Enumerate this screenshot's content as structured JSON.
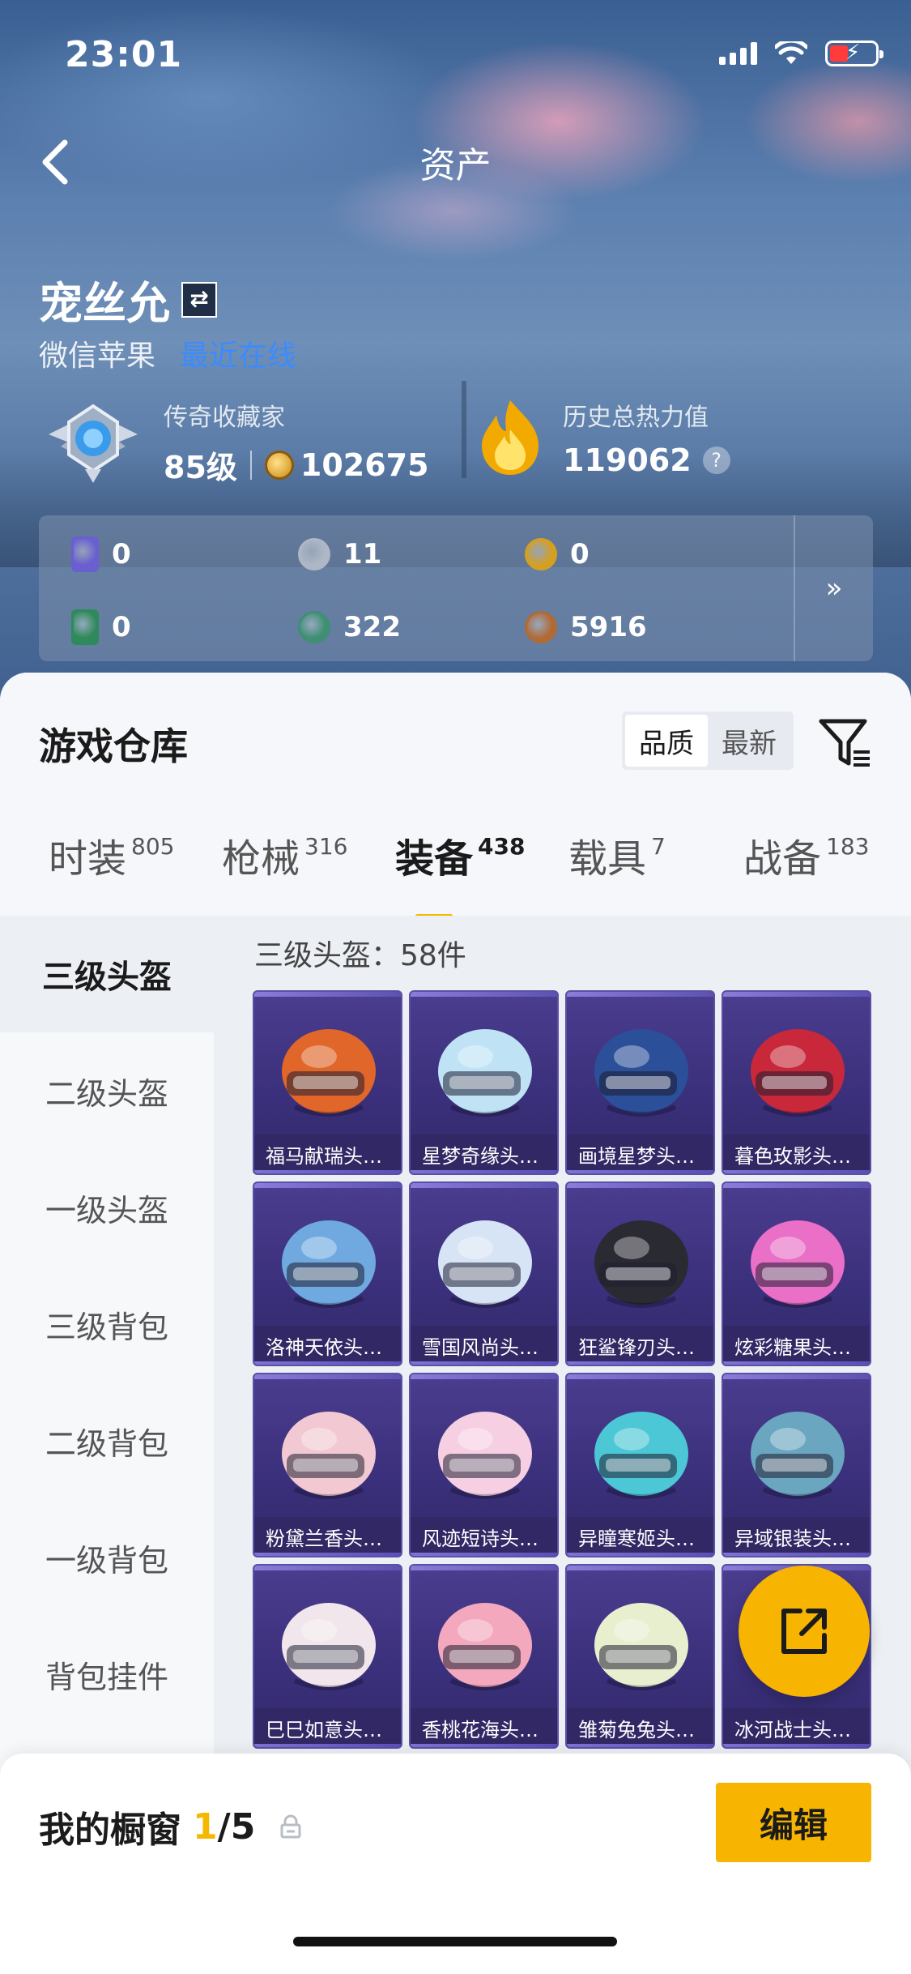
{
  "status_bar": {
    "time": "23:01"
  },
  "nav": {
    "title": "资产"
  },
  "profile": {
    "name": "宠丝允",
    "platform": "微信苹果",
    "status": "最近在线",
    "collector": {
      "title": "传奇收藏家",
      "level": "85级",
      "coins": "102675"
    },
    "heat": {
      "title": "历史总热力值",
      "value": "119062",
      "help": "?"
    }
  },
  "currencies": [
    {
      "icon": "purple-card-icon",
      "value": "0",
      "color": "#6a5fd0"
    },
    {
      "icon": "silver-coin-icon",
      "value": "11",
      "color": "#aeb7c5"
    },
    {
      "icon": "gold-medal-icon",
      "value": "0",
      "color": "#d5a021"
    },
    {
      "icon": "green-card-icon",
      "value": "0",
      "color": "#2e8a5a"
    },
    {
      "icon": "green-orb-icon",
      "value": "322",
      "color": "#3e8f73"
    },
    {
      "icon": "bronze-coin-icon",
      "value": "5916",
      "color": "#b06a35"
    }
  ],
  "currency_more": "»",
  "warehouse": {
    "title": "游戏仓库",
    "sort": {
      "quality": "品质",
      "newest": "最新"
    }
  },
  "tabs": [
    {
      "label": "时装",
      "count": "805"
    },
    {
      "label": "枪械",
      "count": "316"
    },
    {
      "label": "装备",
      "count": "438"
    },
    {
      "label": "载具",
      "count": "7"
    },
    {
      "label": "战备",
      "count": "183"
    }
  ],
  "categories": [
    "三级头盔",
    "二级头盔",
    "一级头盔",
    "三级背包",
    "二级背包",
    "一级背包",
    "背包挂件"
  ],
  "subcategory_count": "三级头盔：58件",
  "items": [
    {
      "name": "福马献瑞头…",
      "color": "#e0662a"
    },
    {
      "name": "星梦奇缘头…",
      "color": "#bfe3f5"
    },
    {
      "name": "画境星梦头…",
      "color": "#2c4f9a"
    },
    {
      "name": "暮色玫影头…",
      "color": "#c8283a"
    },
    {
      "name": "洛神天依头…",
      "color": "#6fa9e0"
    },
    {
      "name": "雪国风尚头…",
      "color": "#d7e4f6"
    },
    {
      "name": "狂鲨锋刃头…",
      "color": "#2a2a33"
    },
    {
      "name": "炫彩糖果头…",
      "color": "#ea6fc7"
    },
    {
      "name": "粉黛兰香头…",
      "color": "#f2c9d2"
    },
    {
      "name": "风迹短诗头…",
      "color": "#f6cfe2"
    },
    {
      "name": "异瞳寒姬头…",
      "color": "#4cc7d6"
    },
    {
      "name": "异域银装头…",
      "color": "#6aa6c0"
    },
    {
      "name": "巳巳如意头…",
      "color": "#f1e6ec"
    },
    {
      "name": "香桃花海头…",
      "color": "#f3a8bd"
    },
    {
      "name": "雏菊兔兔头…",
      "color": "#e7efcf"
    },
    {
      "name": "冰河战士头…",
      "color": "#6fb6d8"
    }
  ],
  "showcase": {
    "label": "我的橱窗",
    "current": "1",
    "total": "/5"
  },
  "edit_label": "编辑"
}
